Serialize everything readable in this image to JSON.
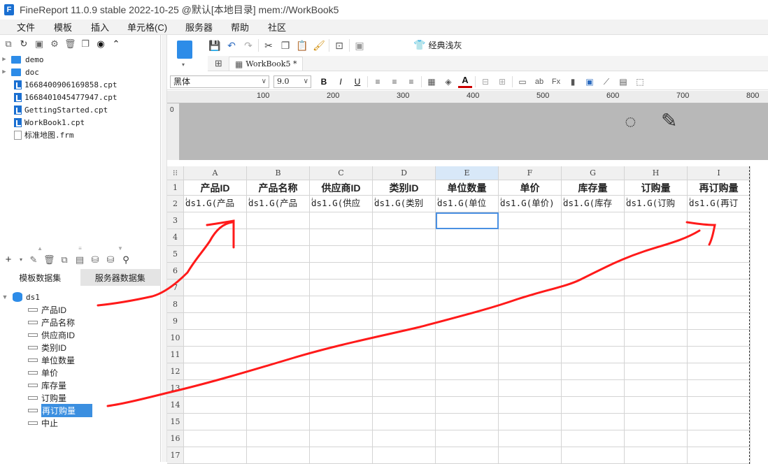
{
  "window": {
    "title": "FineReport 11.0.9 stable 2022-10-25 @默认[本地目录]    mem://WorkBook5"
  },
  "menu": [
    "文件",
    "模板",
    "插入",
    "单元格(C)",
    "服务器",
    "帮助",
    "社区"
  ],
  "files": [
    {
      "name": "demo",
      "type": "folder"
    },
    {
      "name": "doc",
      "type": "folder"
    },
    {
      "name": "1668400906169858.cpt",
      "type": "cpt"
    },
    {
      "name": "1668401045477947.cpt",
      "type": "cpt"
    },
    {
      "name": "GettingStarted.cpt",
      "type": "cpt"
    },
    {
      "name": "WorkBook1.cpt",
      "type": "cpt"
    },
    {
      "name": "标准地图.frm",
      "type": "frm"
    }
  ],
  "dataset_tabs": [
    "模板数据集",
    "服务器数据集"
  ],
  "dataset": {
    "name": "ds1",
    "fields": [
      "产品ID",
      "产品名称",
      "供应商ID",
      "类别ID",
      "单位数量",
      "单价",
      "库存量",
      "订购量",
      "再订购量",
      "中止"
    ],
    "selected": "再订购量"
  },
  "toolbar": {
    "theme_label": "经典浅灰"
  },
  "tab": {
    "label": "WorkBook5 *"
  },
  "format": {
    "font": "黑体",
    "size": "9.0"
  },
  "ruler": {
    "marks": [
      "100",
      "200",
      "300",
      "400",
      "500",
      "600",
      "700",
      "800"
    ],
    "vertical": "0"
  },
  "sheet": {
    "columns": [
      "A",
      "B",
      "C",
      "D",
      "E",
      "F",
      "G",
      "H",
      "I"
    ],
    "rows": [
      "1",
      "2",
      "3",
      "4",
      "5",
      "6",
      "7",
      "8",
      "9",
      "10",
      "11",
      "12",
      "13",
      "14",
      "15",
      "16",
      "17"
    ],
    "header_row": [
      "产品ID",
      "产品名称",
      "供应商ID",
      "类别ID",
      "单位数量",
      "单价",
      "库存量",
      "订购量",
      "再订购量"
    ],
    "data_row": [
      "ds1.G(产品",
      "ds1.G(产品",
      "ds1.G(供应",
      "ds1.G(类别",
      "ds1.G(单位",
      "ds1.G(单价)",
      "ds1.G(库存",
      "ds1.G(订购",
      "ds1.G(再订"
    ],
    "selected_cell": "E3"
  },
  "colors": {
    "accent": "#1a6fd1",
    "selection": "#4a90e2",
    "annotation": "#ff1a1a"
  }
}
